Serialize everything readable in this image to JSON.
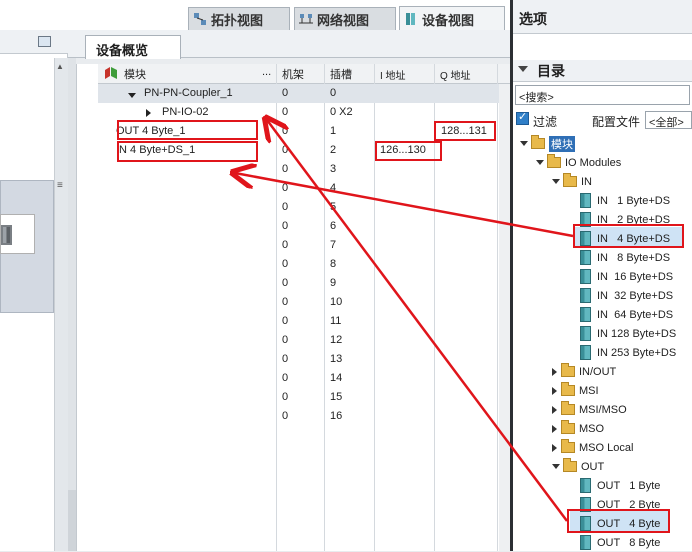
{
  "tabs": [
    {
      "label": "拓扑视图",
      "icon": "topology-icon",
      "active": false
    },
    {
      "label": "网络视图",
      "icon": "network-icon",
      "active": false
    },
    {
      "label": "设备视图",
      "icon": "device-icon",
      "active": true
    }
  ],
  "overview": {
    "tab_label": "设备概览",
    "columns": [
      "模块",
      "...",
      "机架",
      "插槽",
      "I 地址",
      "Q 地址"
    ],
    "rows": [
      {
        "module": "PN-PN-Coupler_1",
        "rack": "0",
        "slot": "0",
        "i_addr": "",
        "q_addr": ""
      },
      {
        "module": "PN-IO-02",
        "rack": "0",
        "slot": "0 X2",
        "i_addr": "",
        "q_addr": ""
      },
      {
        "module": "OUT  4 Byte_1",
        "rack": "0",
        "slot": "1",
        "i_addr": "",
        "q_addr": "128...131"
      },
      {
        "module": "IN  4 Byte+DS_1",
        "rack": "0",
        "slot": "2",
        "i_addr": "126...130",
        "q_addr": ""
      },
      {
        "module": "",
        "rack": "0",
        "slot": "3",
        "i_addr": "",
        "q_addr": ""
      },
      {
        "module": "",
        "rack": "0",
        "slot": "4",
        "i_addr": "",
        "q_addr": ""
      },
      {
        "module": "",
        "rack": "0",
        "slot": "5",
        "i_addr": "",
        "q_addr": ""
      },
      {
        "module": "",
        "rack": "0",
        "slot": "6",
        "i_addr": "",
        "q_addr": ""
      },
      {
        "module": "",
        "rack": "0",
        "slot": "7",
        "i_addr": "",
        "q_addr": ""
      },
      {
        "module": "",
        "rack": "0",
        "slot": "8",
        "i_addr": "",
        "q_addr": ""
      },
      {
        "module": "",
        "rack": "0",
        "slot": "9",
        "i_addr": "",
        "q_addr": ""
      },
      {
        "module": "",
        "rack": "0",
        "slot": "10",
        "i_addr": "",
        "q_addr": ""
      },
      {
        "module": "",
        "rack": "0",
        "slot": "11",
        "i_addr": "",
        "q_addr": ""
      },
      {
        "module": "",
        "rack": "0",
        "slot": "12",
        "i_addr": "",
        "q_addr": ""
      },
      {
        "module": "",
        "rack": "0",
        "slot": "13",
        "i_addr": "",
        "q_addr": ""
      },
      {
        "module": "",
        "rack": "0",
        "slot": "14",
        "i_addr": "",
        "q_addr": ""
      },
      {
        "module": "",
        "rack": "0",
        "slot": "15",
        "i_addr": "",
        "q_addr": ""
      },
      {
        "module": "",
        "rack": "0",
        "slot": "16",
        "i_addr": "",
        "q_addr": ""
      }
    ]
  },
  "options": {
    "title": "选项",
    "catalog_title": "目录",
    "search_placeholder": "<搜索>",
    "filter_label": "过滤",
    "profile_label": "配置文件",
    "profile_value": "<全部>",
    "tree": [
      {
        "label": "模块",
        "kind": "folder",
        "expanded": true
      },
      {
        "label": "IO Modules",
        "kind": "folder",
        "expanded": true
      },
      {
        "label": "IN",
        "kind": "folder",
        "expanded": true
      },
      {
        "label": "IN   1 Byte+DS",
        "kind": "module"
      },
      {
        "label": "IN   2 Byte+DS",
        "kind": "module"
      },
      {
        "label": "IN   4 Byte+DS",
        "kind": "module",
        "selected": true
      },
      {
        "label": "IN   8 Byte+DS",
        "kind": "module"
      },
      {
        "label": "IN  16 Byte+DS",
        "kind": "module"
      },
      {
        "label": "IN  32 Byte+DS",
        "kind": "module"
      },
      {
        "label": "IN  64 Byte+DS",
        "kind": "module"
      },
      {
        "label": "IN 128 Byte+DS",
        "kind": "module"
      },
      {
        "label": "IN 253 Byte+DS",
        "kind": "module"
      },
      {
        "label": "IN/OUT",
        "kind": "folder",
        "expanded": false
      },
      {
        "label": "MSI",
        "kind": "folder",
        "expanded": false
      },
      {
        "label": "MSI/MSO",
        "kind": "folder",
        "expanded": false
      },
      {
        "label": "MSO",
        "kind": "folder",
        "expanded": false
      },
      {
        "label": "MSO Local",
        "kind": "folder",
        "expanded": false
      },
      {
        "label": "OUT",
        "kind": "folder",
        "expanded": true
      },
      {
        "label": "OUT   1 Byte",
        "kind": "module"
      },
      {
        "label": "OUT   2 Byte",
        "kind": "module"
      },
      {
        "label": "OUT   4 Byte",
        "kind": "module",
        "selected": true
      },
      {
        "label": "OUT   8 Byte",
        "kind": "module"
      }
    ]
  },
  "colors": {
    "annotation_red": "#e0151b",
    "selection": "#cfe3f5"
  }
}
